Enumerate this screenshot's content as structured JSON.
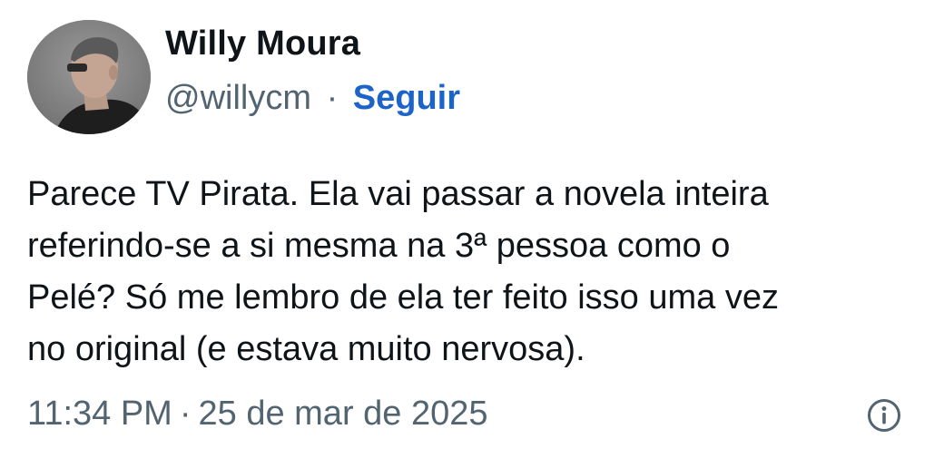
{
  "author": {
    "name": "Willy Moura",
    "handle": "@willycm",
    "separator": "·",
    "follow_label": "Seguir"
  },
  "tweet": {
    "text": "Parece TV Pirata. Ela vai passar a novela inteira\nreferindo-se a si mesma na 3ª pessoa como o\nPelé? Só me lembro de ela ter feito isso uma vez\nno original (e estava muito nervosa).",
    "time": "11:34 PM",
    "separator": "·",
    "date": "25 de mar de 2025"
  },
  "icons": {
    "info": "info-icon",
    "avatar": "user-avatar"
  },
  "colors": {
    "text": "#0f1419",
    "secondary": "#536471",
    "link": "#1d64c8",
    "background": "#ffffff"
  }
}
